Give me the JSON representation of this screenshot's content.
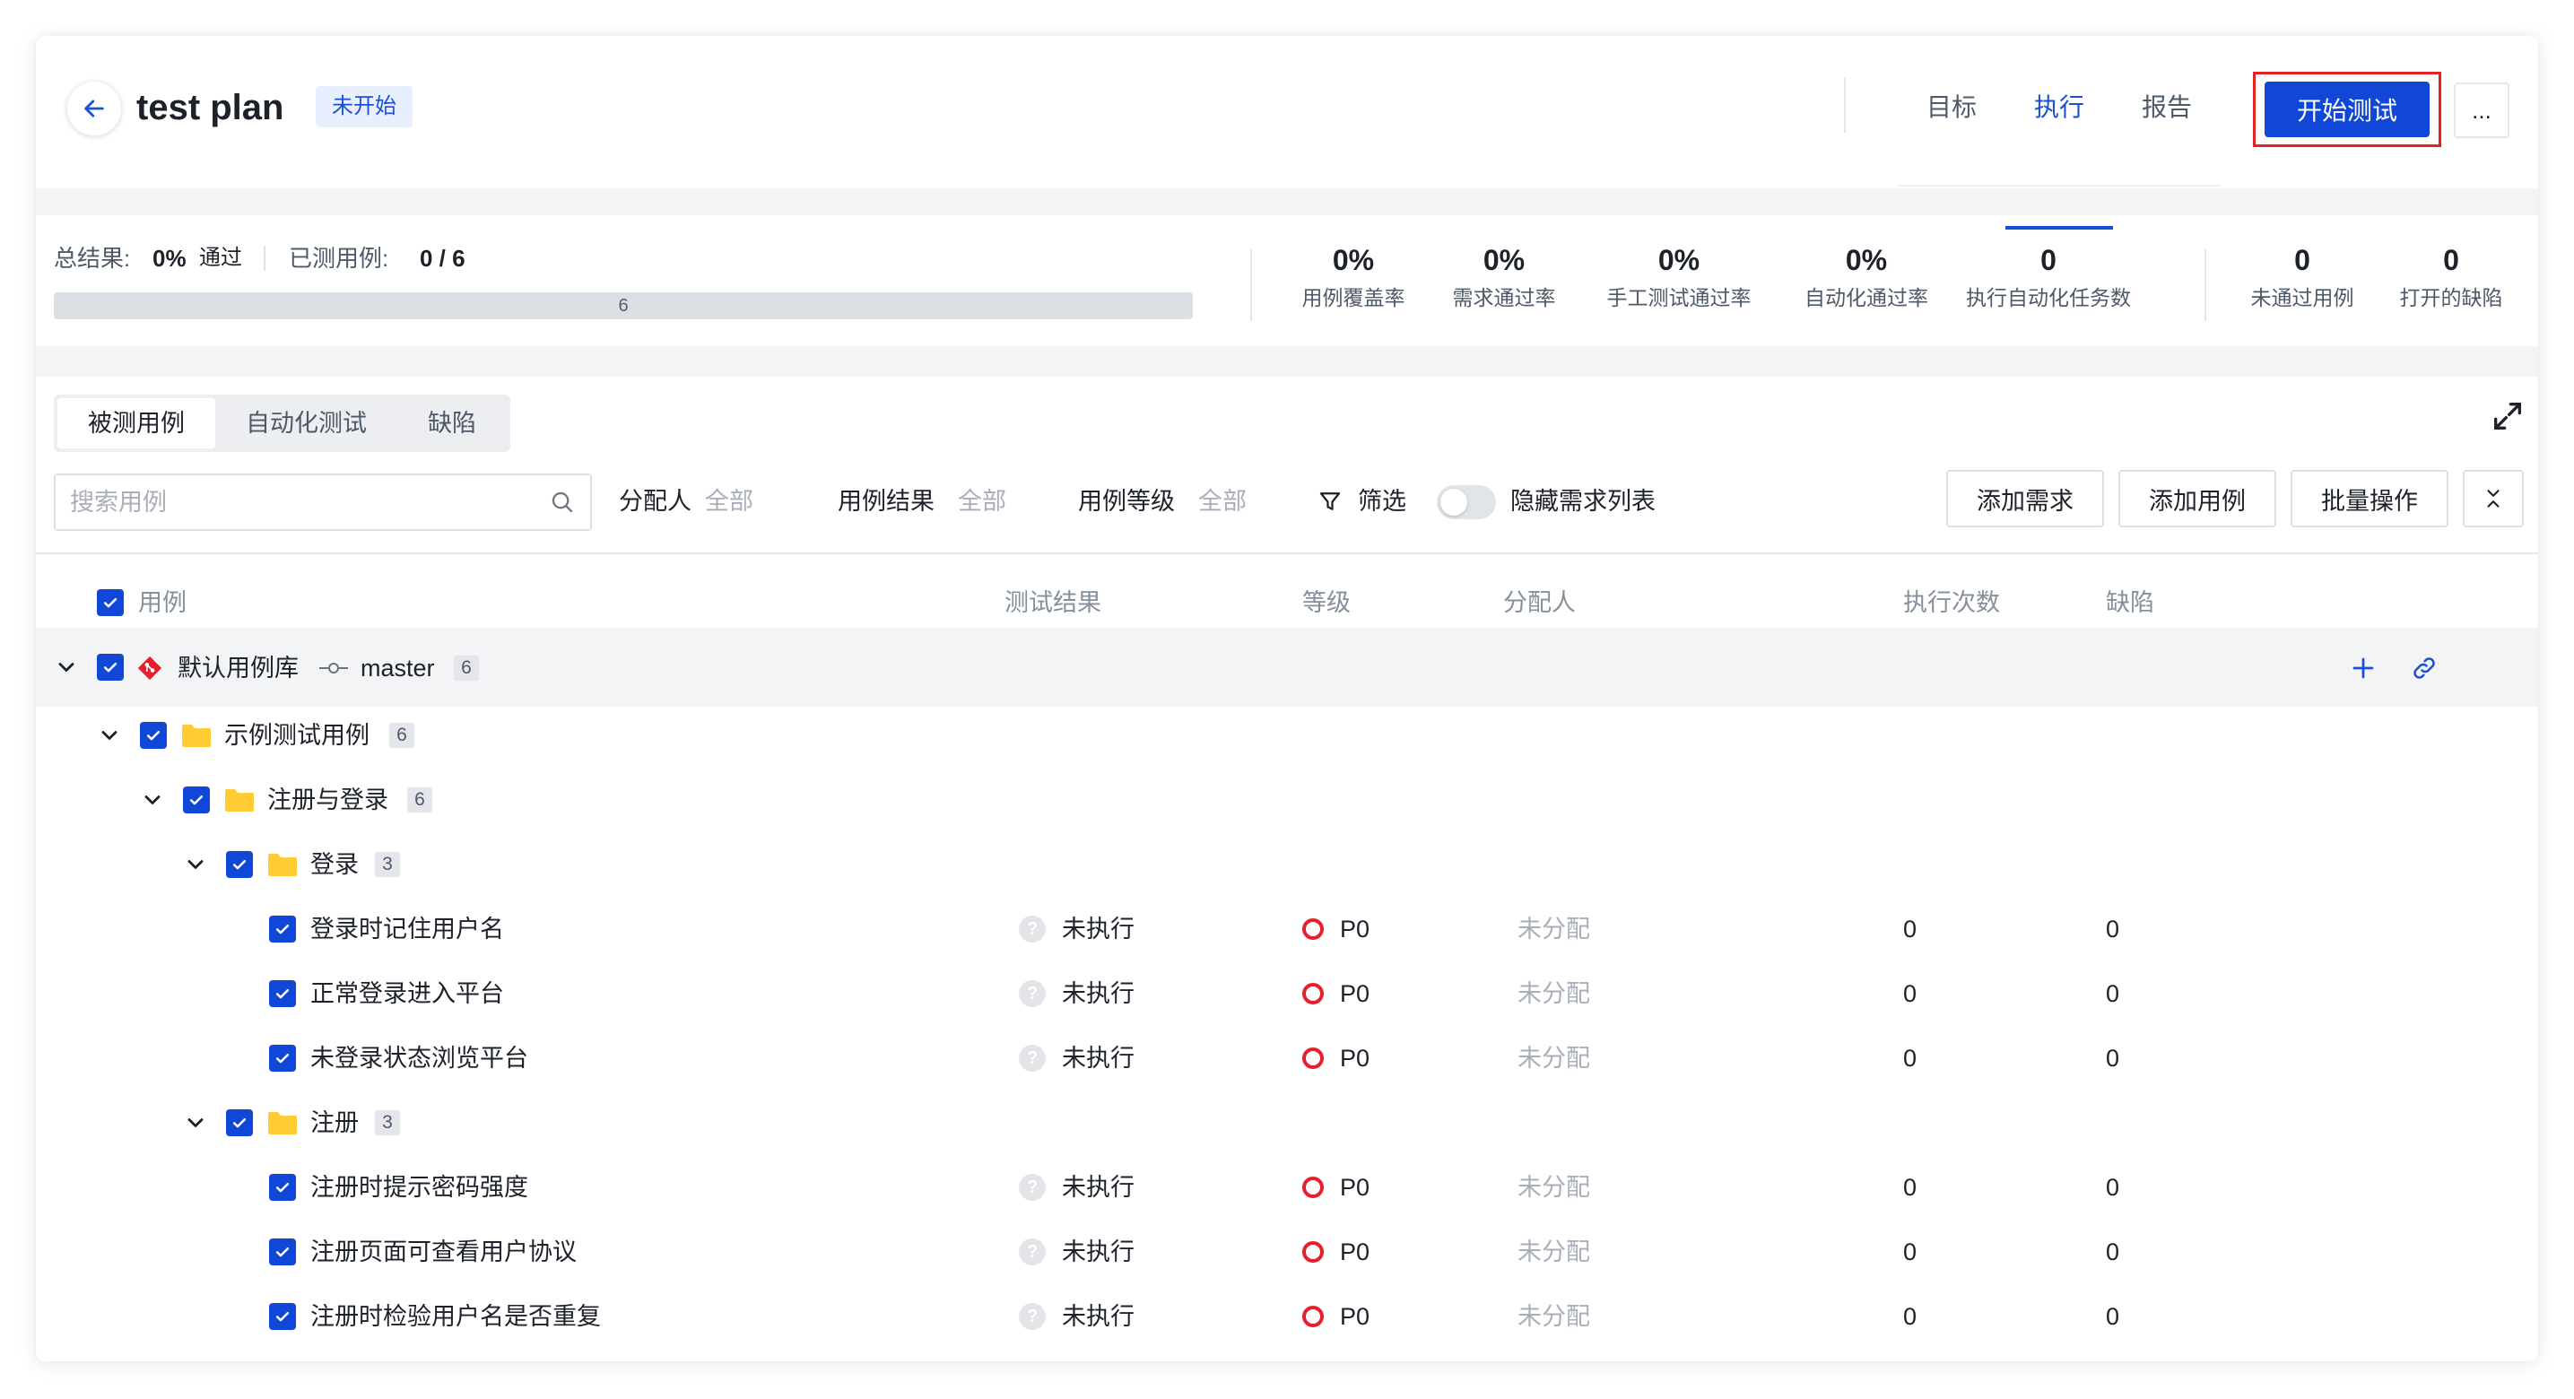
{
  "header": {
    "title": "test plan",
    "status": "未开始",
    "tabs": [
      {
        "label": "目标",
        "active": false
      },
      {
        "label": "执行",
        "active": true
      },
      {
        "label": "报告",
        "active": false
      }
    ],
    "start_button": "开始测试",
    "more_button": "..."
  },
  "summary": {
    "result_label": "总结果:",
    "result_value": "0%",
    "result_pass": "通过",
    "tested_label": "已测用例:",
    "tested_value": "0 / 6",
    "progress_text": "6",
    "progress_fraction": 0
  },
  "stats": [
    {
      "value": "0%",
      "label": "用例覆盖率"
    },
    {
      "value": "0%",
      "label": "需求通过率"
    },
    {
      "value": "0%",
      "label": "手工测试通过率"
    },
    {
      "value": "0%",
      "label": "自动化通过率"
    },
    {
      "value": "0",
      "label": "执行自动化任务数"
    },
    {
      "value": "0",
      "label": "未通过用例"
    },
    {
      "value": "0",
      "label": "打开的缺陷"
    }
  ],
  "subtabs": [
    "被测用例",
    "自动化测试",
    "缺陷"
  ],
  "toolbar": {
    "search_placeholder": "搜索用例",
    "assignee_label": "分配人",
    "assignee_value": "全部",
    "result_label": "用例结果",
    "result_value": "全部",
    "level_label": "用例等级",
    "level_value": "全部",
    "filter_label": "筛选",
    "hide_req_label": "隐藏需求列表",
    "buttons": [
      "添加需求",
      "添加用例",
      "批量操作"
    ]
  },
  "table": {
    "columns": [
      "用例",
      "测试结果",
      "等级",
      "分配人",
      "执行次数",
      "缺陷"
    ],
    "repo": {
      "name": "默认用例库",
      "branch": "master",
      "count": "6"
    },
    "folders": [
      {
        "name": "示例测试用例",
        "count": "6"
      },
      {
        "name": "注册与登录",
        "count": "6"
      },
      {
        "name": "登录",
        "count": "3"
      },
      {
        "name": "注册",
        "count": "3"
      }
    ],
    "cases": [
      {
        "name": "登录时记住用户名",
        "result": "未执行",
        "level": "P0",
        "assignee": "未分配",
        "runs": "0",
        "defects": "0"
      },
      {
        "name": "正常登录进入平台",
        "result": "未执行",
        "level": "P0",
        "assignee": "未分配",
        "runs": "0",
        "defects": "0"
      },
      {
        "name": "未登录状态浏览平台",
        "result": "未执行",
        "level": "P0",
        "assignee": "未分配",
        "runs": "0",
        "defects": "0"
      },
      {
        "name": "注册时提示密码强度",
        "result": "未执行",
        "level": "P0",
        "assignee": "未分配",
        "runs": "0",
        "defects": "0"
      },
      {
        "name": "注册页面可查看用户协议",
        "result": "未执行",
        "level": "P0",
        "assignee": "未分配",
        "runs": "0",
        "defects": "0"
      },
      {
        "name": "注册时检验用户名是否重复",
        "result": "未执行",
        "level": "P0",
        "assignee": "未分配",
        "runs": "0",
        "defects": "0"
      }
    ]
  },
  "colors": {
    "primary": "#1047d6",
    "highlight_border": "#e02424",
    "level_p0": "#e5202c",
    "folder": "#ffcc33"
  }
}
